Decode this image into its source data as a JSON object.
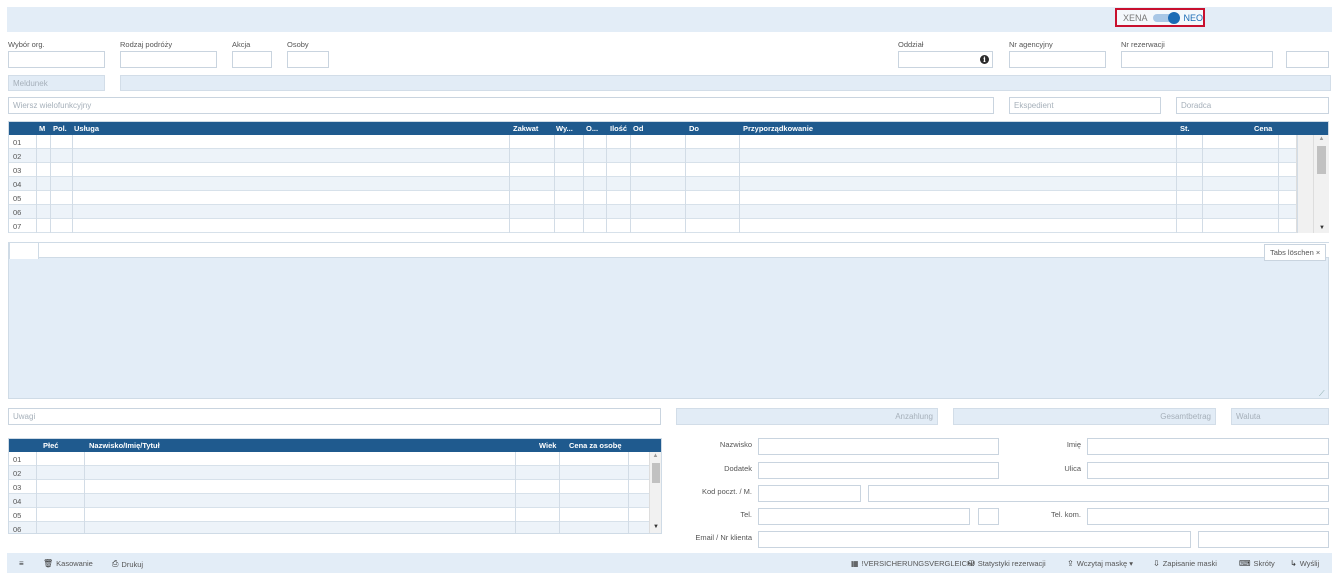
{
  "toggle": {
    "left_label": "XENA",
    "right_label": "NEO",
    "active": "NEO"
  },
  "header_fields": {
    "wybor_org": "Wybór org.",
    "rodzaj_podrozy": "Rodzaj podróży",
    "akcja": "Akcja",
    "osoby": "Osoby",
    "oddzial": "Oddział",
    "nr_agencyjny": "Nr agencyjny",
    "nr_rezerwacji": "Nr rezerwacji"
  },
  "meldunek_placeholder": "Meldunek",
  "wiersz_placeholder": "Wiersz wielofunkcyjny",
  "ekspedient_placeholder": "Ekspedient",
  "doradca_placeholder": "Doradca",
  "service_table": {
    "headers": {
      "m": "M",
      "pol": "Pol.",
      "usluga": "Usługa",
      "zakwat": "Zakwat",
      "wy": "Wy...",
      "o": "O...",
      "ilosc": "Ilość",
      "od": "Od",
      "do": "Do",
      "przyporzadkowanie": "Przyporządkowanie",
      "st": "St.",
      "cena": "Cena"
    },
    "rows": [
      "01",
      "02",
      "03",
      "04",
      "05",
      "06",
      "07"
    ]
  },
  "tabs_clear_label": "Tabs löschen ×",
  "uwagi_placeholder": "Uwagi",
  "anzahlung_label": "Anzahlung",
  "gesamtbetrag_label": "Gesamtbetrag",
  "waluta_placeholder": "Waluta",
  "persons_table": {
    "headers": {
      "plec": "Płeć",
      "nazwisko": "Nazwisko/Imię/Tytuł",
      "wiek": "Wiek",
      "cena": "Cena za osobę"
    },
    "rows": [
      "01",
      "02",
      "03",
      "04",
      "05",
      "06"
    ]
  },
  "customer_form": {
    "nazwisko": "Nazwisko",
    "imie": "Imię",
    "dodatek": "Dodatek",
    "ulica": "Ulica",
    "kod": "Kod poczt. / M.",
    "tel": "Tel.",
    "tel_kom": "Tel. kom.",
    "email": "Email / Nr klienta"
  },
  "footer": {
    "menu_icon": "≡",
    "kasowanie": "Kasowanie",
    "drukuj": "Drukuj",
    "versicherung": "!VERSICHERUNGSVERGLEICH!",
    "statystyki": "Statystyki rezerwacji",
    "wczytaj": "Wczytaj maskę ▾",
    "zapisanie": "Zapisanie maski",
    "skroty": "Skróty",
    "wyslij": "Wyślij"
  }
}
